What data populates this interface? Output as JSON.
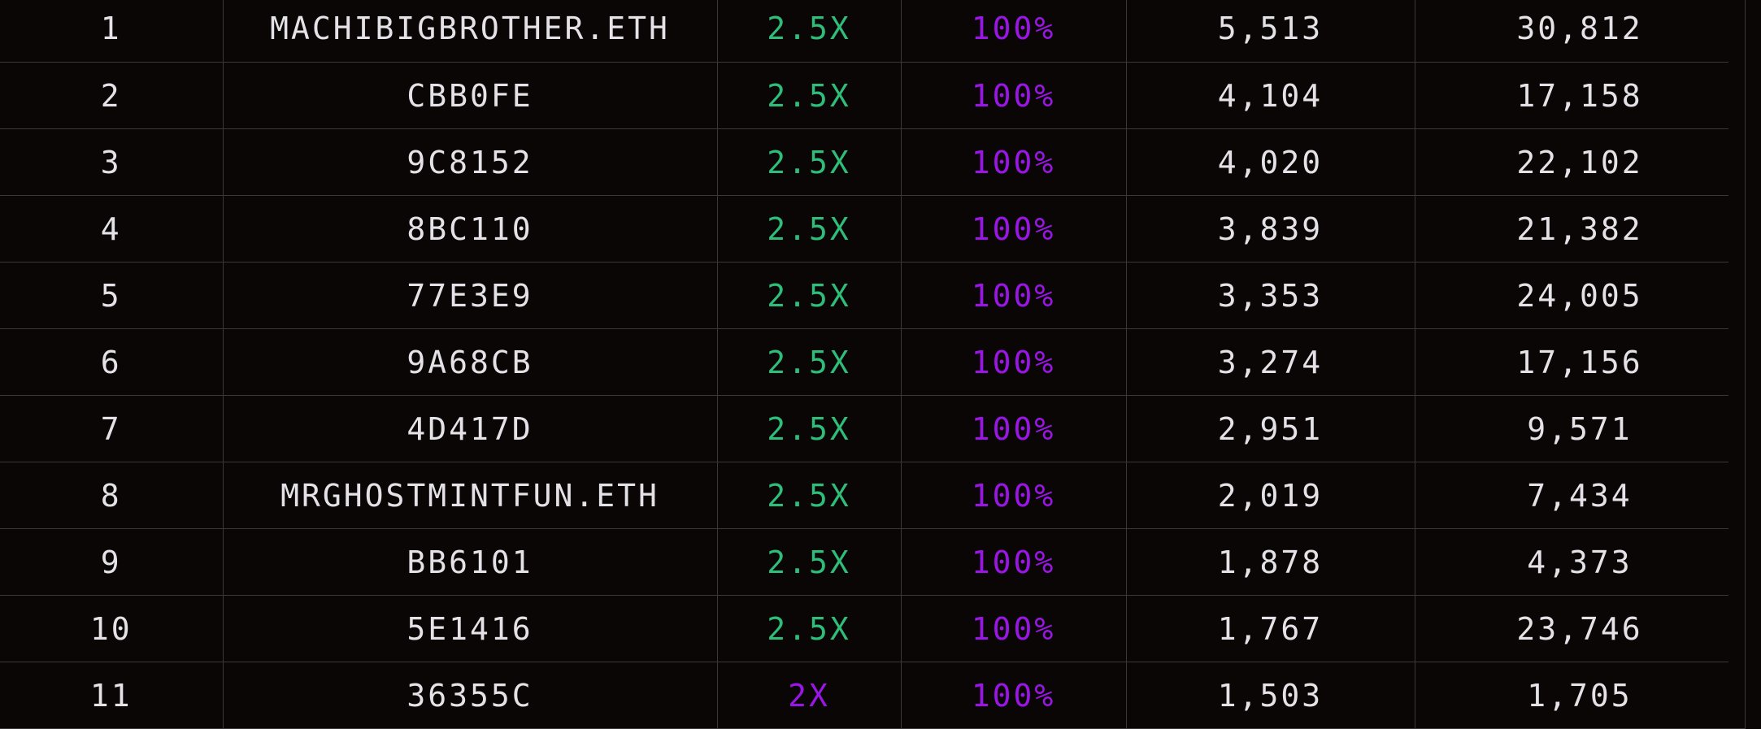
{
  "colors": {
    "background": "#0a0606",
    "grid_line": "#3a3838",
    "text": "#e4e2e6",
    "multiplier_green": "#2fbd7a",
    "accent_purple": "#9a16e6"
  },
  "rows": [
    {
      "rank": "1",
      "name": "MACHIBIGBROTHER.ETH",
      "multiplier": "2.5X",
      "multiplier_color": "green",
      "percent": "100%",
      "points": "5,513",
      "total": "30,812"
    },
    {
      "rank": "2",
      "name": "CBB0FE",
      "multiplier": "2.5X",
      "multiplier_color": "green",
      "percent": "100%",
      "points": "4,104",
      "total": "17,158"
    },
    {
      "rank": "3",
      "name": "9C8152",
      "multiplier": "2.5X",
      "multiplier_color": "green",
      "percent": "100%",
      "points": "4,020",
      "total": "22,102"
    },
    {
      "rank": "4",
      "name": "8BC110",
      "multiplier": "2.5X",
      "multiplier_color": "green",
      "percent": "100%",
      "points": "3,839",
      "total": "21,382"
    },
    {
      "rank": "5",
      "name": "77E3E9",
      "multiplier": "2.5X",
      "multiplier_color": "green",
      "percent": "100%",
      "points": "3,353",
      "total": "24,005"
    },
    {
      "rank": "6",
      "name": "9A68CB",
      "multiplier": "2.5X",
      "multiplier_color": "green",
      "percent": "100%",
      "points": "3,274",
      "total": "17,156"
    },
    {
      "rank": "7",
      "name": "4D417D",
      "multiplier": "2.5X",
      "multiplier_color": "green",
      "percent": "100%",
      "points": "2,951",
      "total": "9,571"
    },
    {
      "rank": "8",
      "name": "MRGHOSTMINTFUN.ETH",
      "multiplier": "2.5X",
      "multiplier_color": "green",
      "percent": "100%",
      "points": "2,019",
      "total": "7,434"
    },
    {
      "rank": "9",
      "name": "BB6101",
      "multiplier": "2.5X",
      "multiplier_color": "green",
      "percent": "100%",
      "points": "1,878",
      "total": "4,373"
    },
    {
      "rank": "10",
      "name": "5E1416",
      "multiplier": "2.5X",
      "multiplier_color": "green",
      "percent": "100%",
      "points": "1,767",
      "total": "23,746"
    },
    {
      "rank": "11",
      "name": "36355C",
      "multiplier": "2X",
      "multiplier_color": "purple",
      "percent": "100%",
      "points": "1,503",
      "total": "1,705"
    }
  ]
}
